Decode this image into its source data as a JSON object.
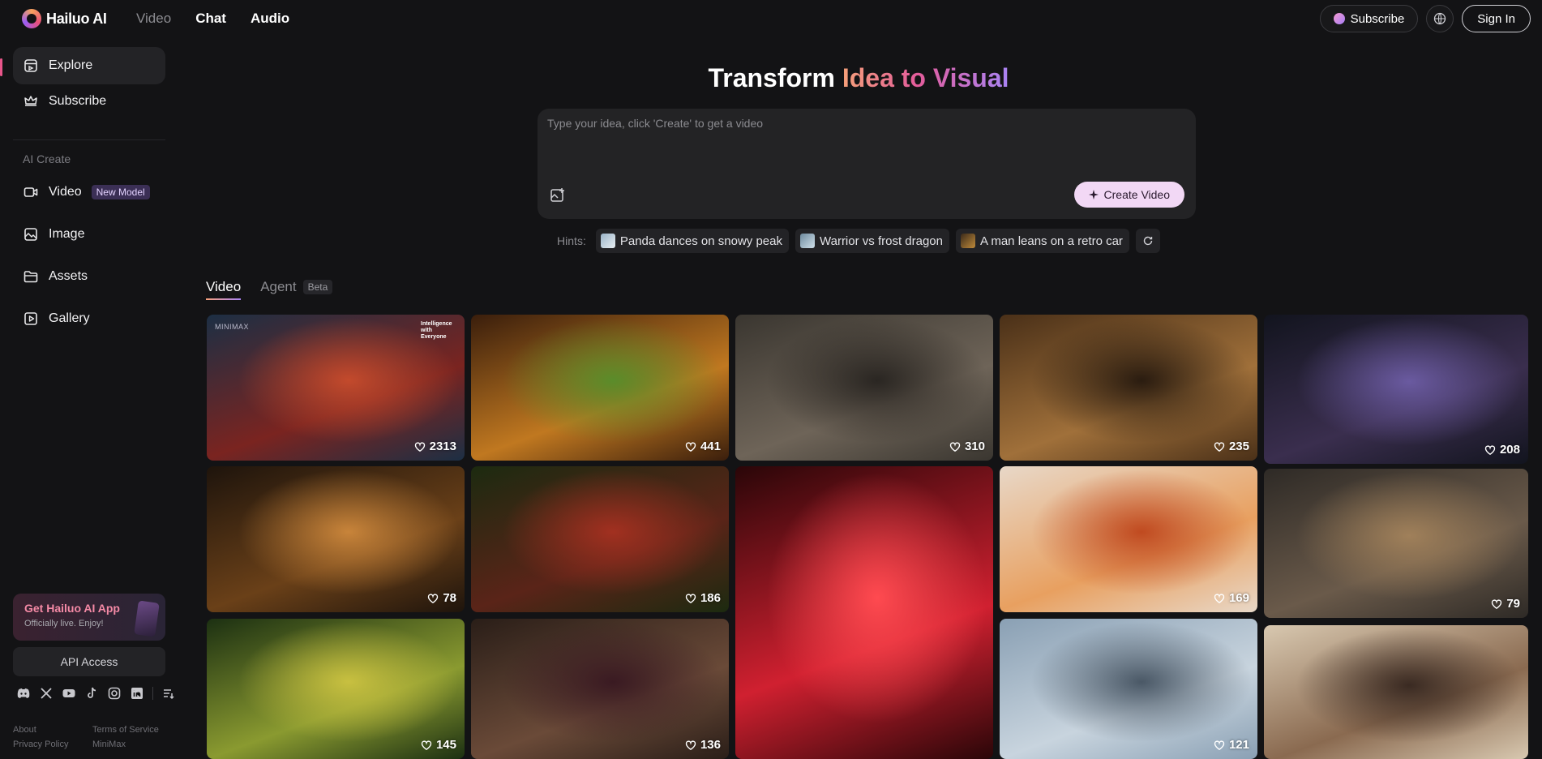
{
  "brand": {
    "name": "Hailuo AI"
  },
  "nav": {
    "video": "Video",
    "chat": "Chat",
    "audio": "Audio"
  },
  "topright": {
    "subscribe": "Subscribe",
    "signin": "Sign In"
  },
  "sidebar": {
    "explore": "Explore",
    "subscribe": "Subscribe",
    "section_heading": "AI Create",
    "video": "Video",
    "video_badge": "New Model",
    "image": "Image",
    "assets": "Assets",
    "gallery": "Gallery",
    "app_title": "Get Hailuo AI App",
    "app_subtitle": "Officially live. Enjoy!",
    "api": "API Access",
    "footer": {
      "about": "About",
      "terms": "Terms of Service",
      "privacy": "Privacy Policy",
      "minimax": "MiniMax"
    }
  },
  "hero": {
    "title_plain": "Transform ",
    "title_grad": "Idea to Visual"
  },
  "prompt": {
    "placeholder": "Type your idea, click 'Create' to get a video",
    "create": "Create Video"
  },
  "hints": {
    "label": "Hints:",
    "items": [
      "Panda dances on snowy peak",
      "Warrior vs frost dragon",
      "A man leans on a retro car"
    ]
  },
  "tabs": {
    "video": "Video",
    "agent": "Agent",
    "agent_badge": "Beta"
  },
  "card_watermark": {
    "brand": "MINIMAX",
    "slogan": "Intelligence with Everyone"
  },
  "cards": [
    {
      "likes": "2313",
      "colors": [
        "#1c2f44",
        "#7a2420",
        "#c34a2c"
      ]
    },
    {
      "likes": "441",
      "colors": [
        "#3a1e0c",
        "#c07820",
        "#5a8c2a"
      ]
    },
    {
      "likes": "310",
      "colors": [
        "#3a3630",
        "#6e6458",
        "#2a2622"
      ]
    },
    {
      "likes": "235",
      "colors": [
        "#4a3018",
        "#a0703a",
        "#2a1c10"
      ]
    },
    {
      "likes": "208",
      "colors": [
        "#12141e",
        "#3a2e4e",
        "#6a5aa0"
      ]
    },
    {
      "likes": "78",
      "colors": [
        "#1e140c",
        "#6a4018",
        "#c8843a"
      ]
    },
    {
      "likes": "186",
      "colors": [
        "#1c2a10",
        "#5a2418",
        "#a23020"
      ]
    },
    {
      "likes": "",
      "colors": [
        "#2a0608",
        "#d02030",
        "#ff4a50"
      ]
    },
    {
      "likes": "169",
      "colors": [
        "#e8d8c8",
        "#e8a060",
        "#c04a20"
      ]
    },
    {
      "likes": "79",
      "colors": [
        "#2e2a26",
        "#6a5a4a",
        "#a0805a"
      ]
    },
    {
      "likes": "145",
      "colors": [
        "#1c3012",
        "#8a9a30",
        "#c8c040"
      ]
    },
    {
      "likes": "136",
      "colors": [
        "#2a1e18",
        "#6a4a38",
        "#3a1a22"
      ]
    },
    {
      "likes": "121",
      "colors": [
        "#8aa0b4",
        "#c8d4de",
        "#4a5866"
      ]
    },
    {
      "likes": "",
      "colors": [
        "#d8c8b0",
        "#8a6a50",
        "#3a2a22"
      ]
    }
  ]
}
